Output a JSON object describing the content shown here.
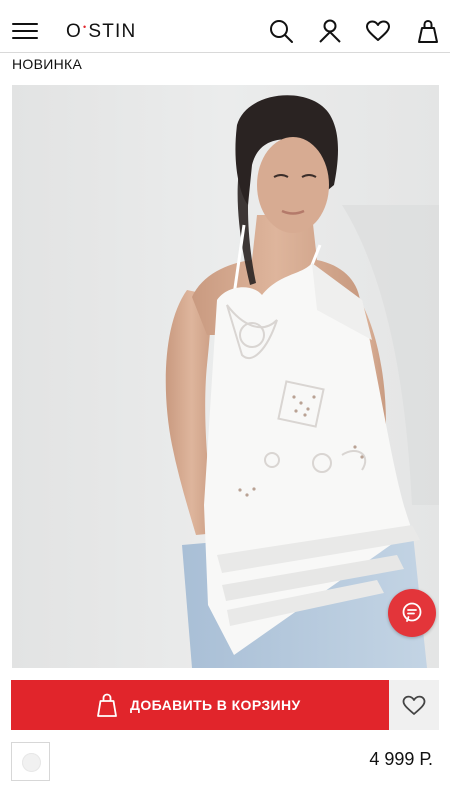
{
  "header": {
    "logo": {
      "left": "O",
      "dot": "•",
      "right": "STIN"
    },
    "icons": [
      "menu-icon",
      "search-icon",
      "user-icon",
      "heart-icon",
      "bag-icon"
    ]
  },
  "product": {
    "badge": "НОВИНКА",
    "price": "4 999 Р.",
    "swatch_color": "#f1f1f1"
  },
  "actions": {
    "add_to_cart_label": "ДОБАВИТЬ В КОРЗИНУ",
    "accent_color": "#e1252b"
  }
}
